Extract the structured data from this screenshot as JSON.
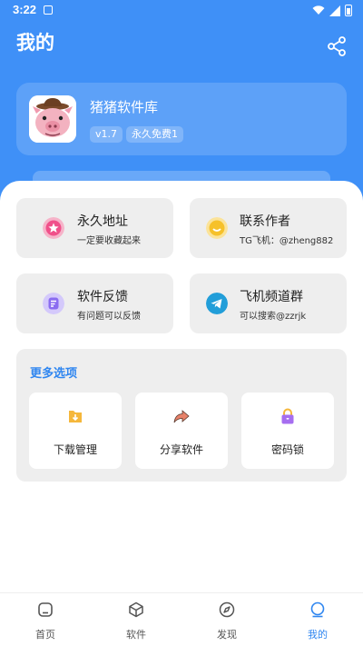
{
  "status_bar": {
    "time": "3:22"
  },
  "header": {
    "title": "我的",
    "share_icon": "share-icon"
  },
  "profile": {
    "app_name": "猪猪软件库",
    "version": "v1.7",
    "badge": "永久免费1",
    "avatar": "pig-cowboy-avatar"
  },
  "cards": [
    {
      "title": "永久地址",
      "subtitle": "一定要收藏起来",
      "icon": "star-icon",
      "color": "#f0508a"
    },
    {
      "title": "联系作者",
      "subtitle": "TG飞机：@zheng882",
      "icon": "smile-icon",
      "color": "#f6c12a"
    },
    {
      "title": "软件反馈",
      "subtitle": "有问题可以反馈",
      "icon": "feedback-icon",
      "color": "#8a6cf0"
    },
    {
      "title": "飞机频道群",
      "subtitle": "可以搜索@zzrjk",
      "icon": "telegram-icon",
      "color": "#229ed9"
    }
  ],
  "more": {
    "title": "更多选项",
    "options": [
      {
        "label": "下载管理",
        "icon": "download-folder-icon",
        "color": "#f5b73b"
      },
      {
        "label": "分享软件",
        "icon": "share-arrow-icon",
        "color": "#e8826a"
      },
      {
        "label": "密码锁",
        "icon": "lock-icon",
        "color": "#a66ef0"
      }
    ]
  },
  "bottom_nav": [
    {
      "label": "首页",
      "icon": "home-icon"
    },
    {
      "label": "软件",
      "icon": "cube-icon"
    },
    {
      "label": "发现",
      "icon": "compass-icon"
    },
    {
      "label": "我的",
      "icon": "profile-icon",
      "active": true
    }
  ],
  "colors": {
    "primary": "#3f90f7",
    "accent": "#2f86f0",
    "card_bg": "#eeeeee"
  }
}
